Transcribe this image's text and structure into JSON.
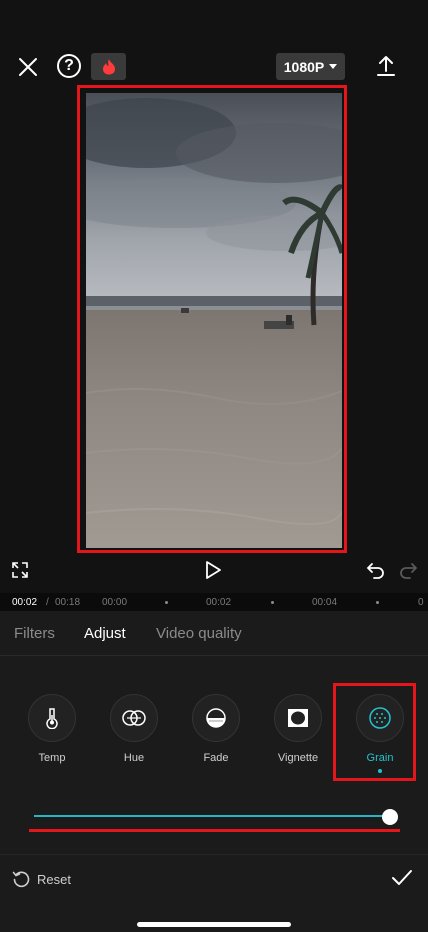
{
  "header": {
    "close_icon": "close-icon",
    "help_label": "?",
    "hot_icon": "flame-icon",
    "resolution_label": "1080P",
    "export_icon": "export-upload-icon"
  },
  "player": {
    "fullscreen_icon": "expand-icon",
    "play_icon": "play-icon",
    "undo_icon": "undo-icon",
    "redo_icon": "redo-icon"
  },
  "timeline": {
    "current_time": "00:02",
    "separator": "/",
    "total_time": "00:18",
    "ticks": [
      "00:00",
      "00:02",
      "00:04",
      "0"
    ]
  },
  "tabs": [
    {
      "label": "Filters",
      "active": false
    },
    {
      "label": "Adjust",
      "active": true
    },
    {
      "label": "Video quality",
      "active": false
    }
  ],
  "tools": [
    {
      "label": "Temp",
      "icon": "thermometer-icon"
    },
    {
      "label": "Hue",
      "icon": "hue-circles-icon"
    },
    {
      "label": "Fade",
      "icon": "fade-icon"
    },
    {
      "label": "Vignette",
      "icon": "vignette-icon"
    },
    {
      "label": "Grain",
      "icon": "grain-icon",
      "selected": true
    }
  ],
  "slider": {
    "value_fraction": 1.0
  },
  "footer": {
    "reset_label": "Reset",
    "confirm_icon": "checkmark-icon"
  },
  "colors": {
    "accent": "#21c3d0",
    "highlight_box": "#e5151c",
    "background": "#121212"
  }
}
